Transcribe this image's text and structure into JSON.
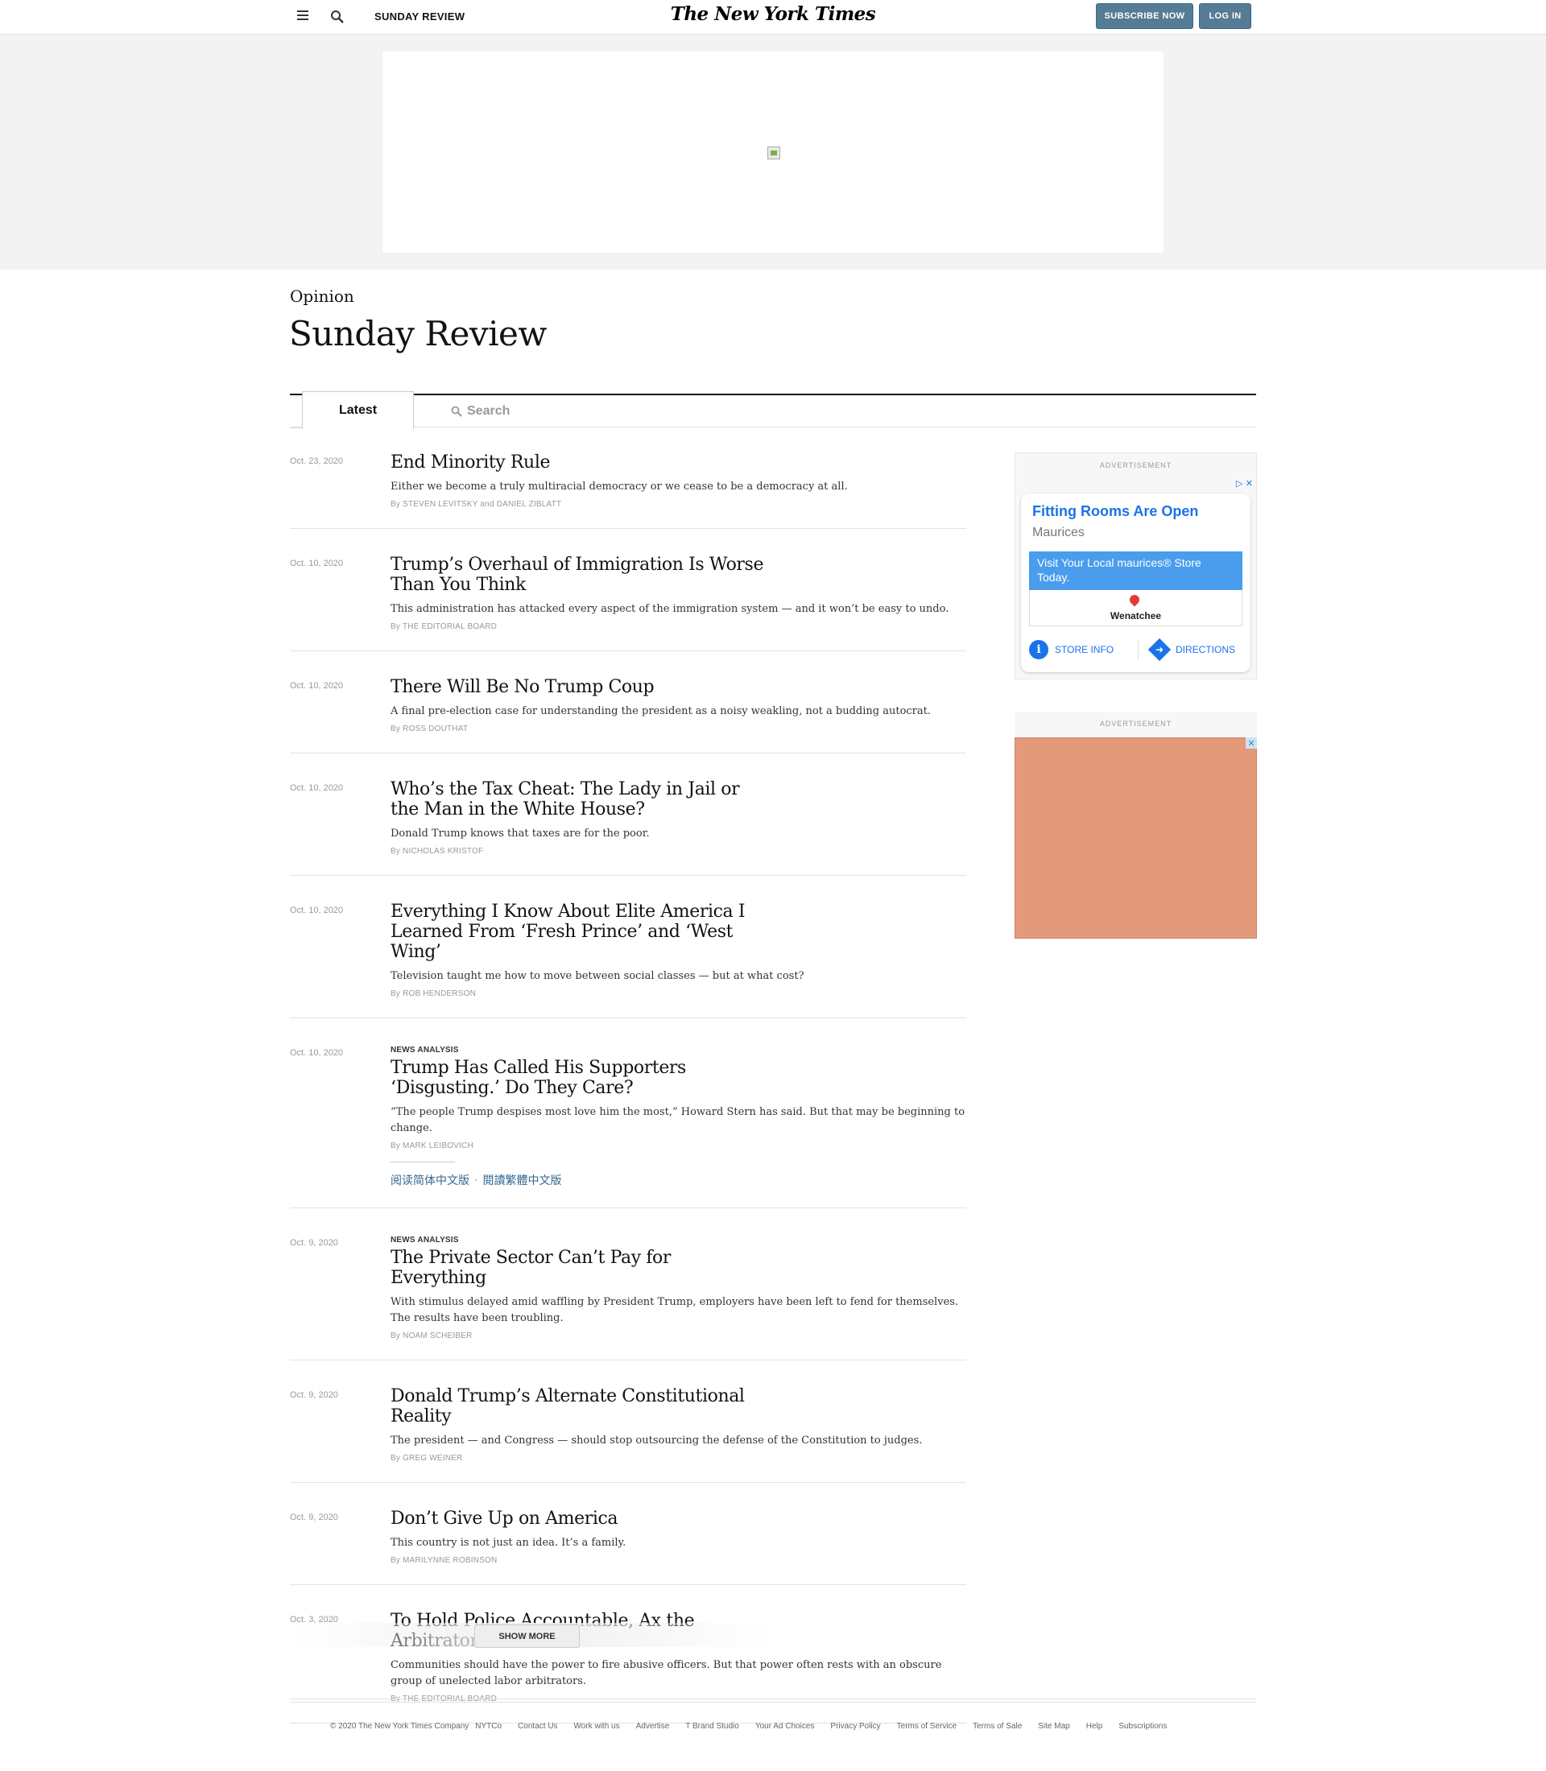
{
  "header": {
    "section": "SUNDAY REVIEW",
    "masthead": "The New York Times",
    "subscribe": "SUBSCRIBE NOW",
    "login": "LOG IN"
  },
  "page": {
    "kicker": "Opinion",
    "title": "Sunday Review"
  },
  "tabs": {
    "latest": "Latest",
    "search": "Search"
  },
  "stories": [
    {
      "date": "Oct. 23, 2020",
      "label": "",
      "hed": "End Minority Rule",
      "summary": "Either we become a truly multiracial democracy or we cease to be a democracy at all.",
      "byline": "By STEVEN LEVITSKY and DANIEL ZIBLATT"
    },
    {
      "date": "Oct. 10, 2020",
      "label": "",
      "hed": "Trump’s Overhaul of Immigration Is Worse Than You Think",
      "summary": "This administration has attacked every aspect of the immigration system — and it won’t be easy to undo.",
      "byline": "By THE EDITORIAL BOARD"
    },
    {
      "date": "Oct. 10, 2020",
      "label": "",
      "hed": "There Will Be No Trump Coup",
      "summary": "A final pre-election case for understanding the president as a noisy weakling, not a budding autocrat.",
      "byline": "By ROSS DOUTHAT"
    },
    {
      "date": "Oct. 10, 2020",
      "label": "",
      "hed": "Who’s the Tax Cheat: The Lady in Jail or the Man in the White House?",
      "summary": "Donald Trump knows that taxes are for the poor.",
      "byline": "By NICHOLAS KRISTOF"
    },
    {
      "date": "Oct. 10, 2020",
      "label": "",
      "hed": "Everything I Know About Elite America I Learned From ‘Fresh Prince’ and ‘West Wing’",
      "summary": "Television taught me how to move between social classes — but at what cost?",
      "byline": "By ROB HENDERSON"
    },
    {
      "date": "Oct. 10, 2020",
      "label": "NEWS ANALYSIS",
      "hed": "Trump Has Called His Supporters ‘Disgusting.’ Do They Care?",
      "summary": "“The people Trump despises most love him the most,” Howard Stern has said. But that may be beginning to change.",
      "byline": "By MARK LEIBOVICH",
      "translations": [
        "阅读简体中文版",
        "閱讀繁體中文版"
      ],
      "translation_sep": "·"
    },
    {
      "date": "Oct. 9, 2020",
      "label": "NEWS ANALYSIS",
      "hed": "The Private Sector Can’t Pay for Everything",
      "summary": "With stimulus delayed amid waffling by President Trump, employers have been left to fend for themselves. The results have been troubling.",
      "byline": "By NOAM SCHEIBER"
    },
    {
      "date": "Oct. 9, 2020",
      "label": "",
      "hed": "Donald Trump’s Alternate Constitutional Reality",
      "summary": "The president — and Congress — should stop outsourcing the defense of the Constitution to judges.",
      "byline": "By GREG WEINER"
    },
    {
      "date": "Oct. 9, 2020",
      "label": "",
      "hed": "Don’t Give Up on America",
      "summary": "This country is not just an idea. It’s a family.",
      "byline": "By MARILYNNE ROBINSON"
    },
    {
      "date": "Oct. 3, 2020",
      "label": "",
      "hed": "To Hold Police Accountable, Ax the Arbitrators",
      "summary": "Communities should have the power to fire abusive officers. But that power often rests with an obscure group of unelected labor arbitrators.",
      "byline": "By THE EDITORIAL BOARD"
    }
  ],
  "show_more": "SHOW MORE",
  "ads": {
    "label": "ADVERTISEMENT",
    "adchoice": "▷ ✕",
    "close": "✕",
    "card": {
      "title": "Fitting Rooms Are Open",
      "brand": "Maurices",
      "cta": "Visit Your Local maurices® Store Today.",
      "city": "Wenatchee",
      "store_info": "STORE INFO",
      "directions": "DIRECTIONS",
      "info_glyph": "i",
      "dir_glyph": "➜"
    }
  },
  "footer": {
    "copyright": "© 2020 The New York Times Company",
    "links": [
      "NYTCo",
      "Contact Us",
      "Work with us",
      "Advertise",
      "T Brand Studio",
      "Your Ad Choices",
      "Privacy Policy",
      "Terms of Service",
      "Terms of Sale",
      "Site Map",
      "Help",
      "Subscriptions"
    ]
  },
  "colors": {
    "brand_button": "#567b95",
    "link_blue": "#326891",
    "ad_blue": "#1a73e8",
    "ad_salmon": "#e5997b"
  }
}
